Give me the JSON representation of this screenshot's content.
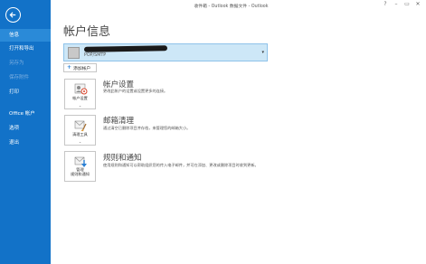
{
  "window": {
    "title": "收件箱 - Outlook 数据文件 - Outlook",
    "help": "?",
    "minimize": "–",
    "restore": "▭",
    "close": "✕"
  },
  "sidebar": {
    "items": [
      {
        "label": "信息"
      },
      {
        "label": "打开和导出"
      },
      {
        "label": "另存为"
      },
      {
        "label": "保存附件"
      },
      {
        "label": "打印"
      },
      {
        "label": "Office 帐户"
      },
      {
        "label": "选项"
      },
      {
        "label": "退出"
      }
    ]
  },
  "page": {
    "title": "帐户信息"
  },
  "account": {
    "type": "POP/SMTP",
    "dropdown_icon": "▾"
  },
  "add_account": {
    "icon": "+",
    "label": "添加帐户"
  },
  "sections": [
    {
      "tile_label": "帐户设置",
      "tile_caret": "⌄",
      "title": "帐户设置",
      "description": "更改此帐户的设置或设置更多的连接。",
      "icon": "account-settings-icon"
    },
    {
      "tile_label": "清理工具",
      "tile_caret": "⌄",
      "title": "邮箱清理",
      "description": "通过清空已删除项目并存档，来管理您的邮箱大小。",
      "icon": "cleanup-tools-icon"
    },
    {
      "tile_label": "管理\n规则和通知",
      "tile_label_line1": "管理",
      "tile_label_line2": "规则和通知",
      "title": "规则和通知",
      "description": "使用规则和通知可以帮助组织您的传入电子邮件，并可在添加、更改或删除项目时收到更新。",
      "icon": "rules-alerts-icon"
    }
  ],
  "colors": {
    "sidebar": "#1272c8",
    "sidebar_active": "#2a8ad8",
    "account_box": "#cde7f7",
    "accent": "#2a7fd4"
  }
}
